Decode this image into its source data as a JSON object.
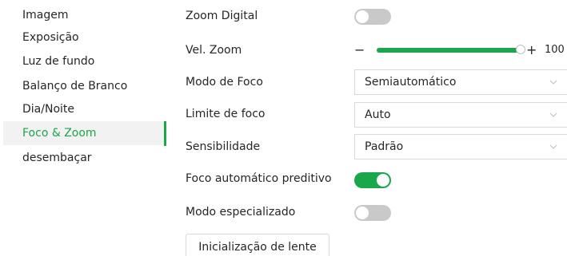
{
  "sidebar": {
    "items": [
      {
        "label": "Imagem"
      },
      {
        "label": "Exposição"
      },
      {
        "label": "Luz de fundo"
      },
      {
        "label": "Balanço de Branco"
      },
      {
        "label": "Dia/Noite"
      },
      {
        "label": "Foco & Zoom"
      },
      {
        "label": "desembaçar"
      }
    ],
    "active_item": "Foco & Zoom"
  },
  "form": {
    "zoom_digital": {
      "label": "Zoom Digital",
      "enabled": false
    },
    "vel_zoom": {
      "label": "Vel. Zoom",
      "minus_icon": "minus-icon",
      "plus_icon": "plus-icon",
      "value": "100",
      "level": 1.0
    },
    "modo_foco": {
      "label": "Modo de Foco",
      "value": "Semiautomático"
    },
    "limite_foco": {
      "label": "Limite de foco",
      "value": "Auto"
    },
    "sensibilidade": {
      "label": "Sensibilidade",
      "value": "Padrão"
    },
    "foco_preditivo": {
      "label": "Foco automático preditivo",
      "enabled": true
    },
    "modo_especializado": {
      "label": "Modo especializado",
      "enabled": false
    },
    "init_button": {
      "label": "Inicialização de lente"
    }
  },
  "colors": {
    "accent": "#1aa64a",
    "toggle_off": "#c9c9c9",
    "active_bg": "#f2f2f2"
  }
}
